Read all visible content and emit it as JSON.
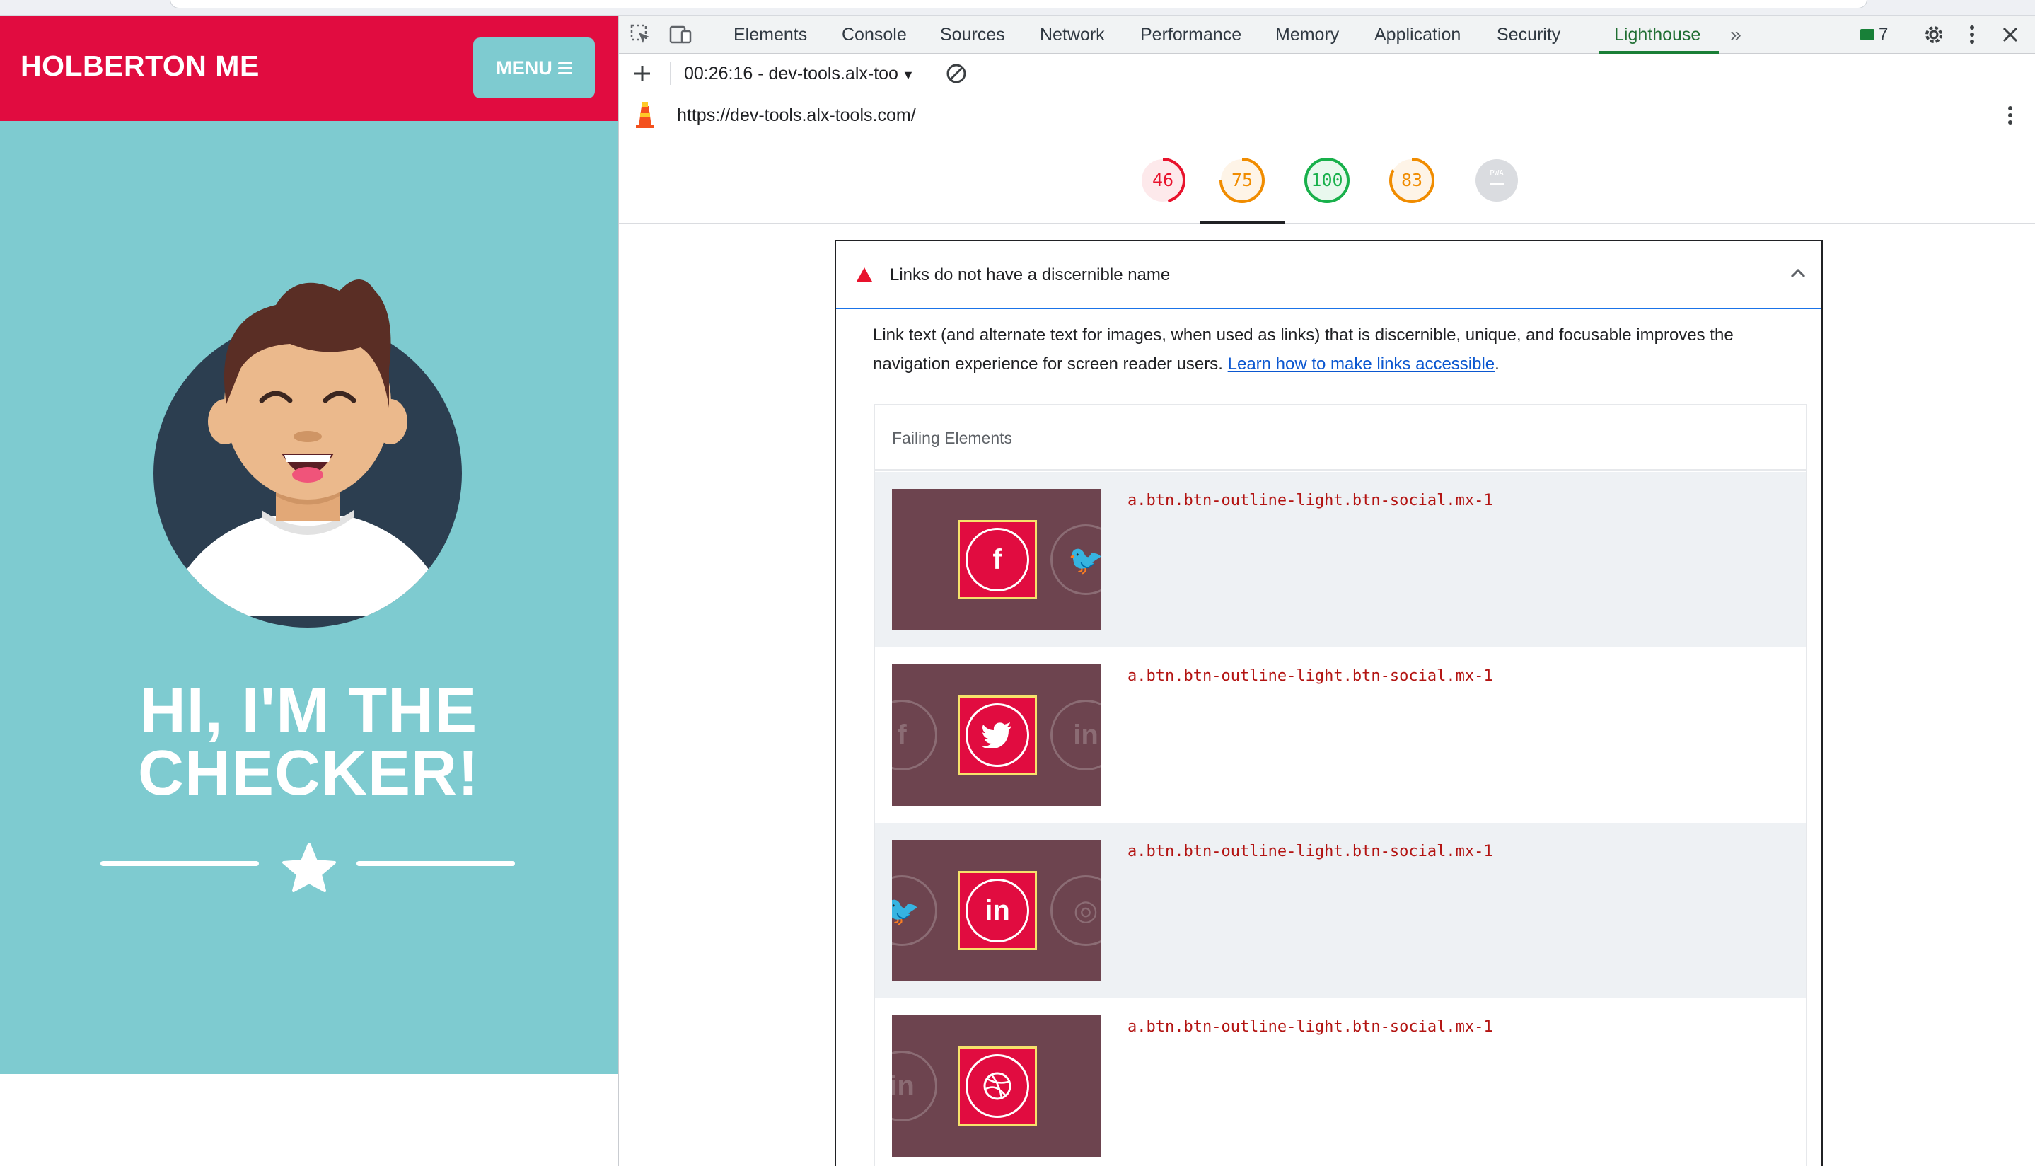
{
  "site": {
    "brand": "HOLBERTON ME",
    "menu_label": "MENU",
    "hero_title_line1": "HI, I'M THE",
    "hero_title_line2": "CHECKER!"
  },
  "devtools": {
    "tabs": [
      "Elements",
      "Console",
      "Sources",
      "Network",
      "Performance",
      "Memory",
      "Application",
      "Security",
      "Lighthouse"
    ],
    "active_tab": "Lighthouse",
    "issues_count": "7",
    "report_label": "00:26:16 - dev-tools.alx-too",
    "url": "https://dev-tools.alx-tools.com/",
    "scores": [
      {
        "value": "46",
        "color": "#e8122c",
        "fraction": 0.46
      },
      {
        "value": "75",
        "color": "#f08c00",
        "fraction": 0.75
      },
      {
        "value": "100",
        "color": "#18b04b",
        "fraction": 1.0
      },
      {
        "value": "83",
        "color": "#f08c00",
        "fraction": 0.83
      },
      {
        "value": "PWA",
        "color": "#b0b3b8",
        "fraction": 0
      }
    ],
    "audit": {
      "title": "Links do not have a discernible name",
      "description": "Link text (and alternate text for images, when used as links) that is discernible, unique, and focusable improves the navigation experience for screen reader users.",
      "link_text": "Learn how to make links accessible",
      "failing_label": "Failing Elements",
      "rows": [
        {
          "selector": "a.btn.btn-outline-light.btn-social.mx-1",
          "icon": "f"
        },
        {
          "selector": "a.btn.btn-outline-light.btn-social.mx-1",
          "icon": "twitter"
        },
        {
          "selector": "a.btn.btn-outline-light.btn-social.mx-1",
          "icon": "in"
        },
        {
          "selector": "a.btn.btn-outline-light.btn-social.mx-1",
          "icon": "dribbble"
        }
      ]
    }
  }
}
